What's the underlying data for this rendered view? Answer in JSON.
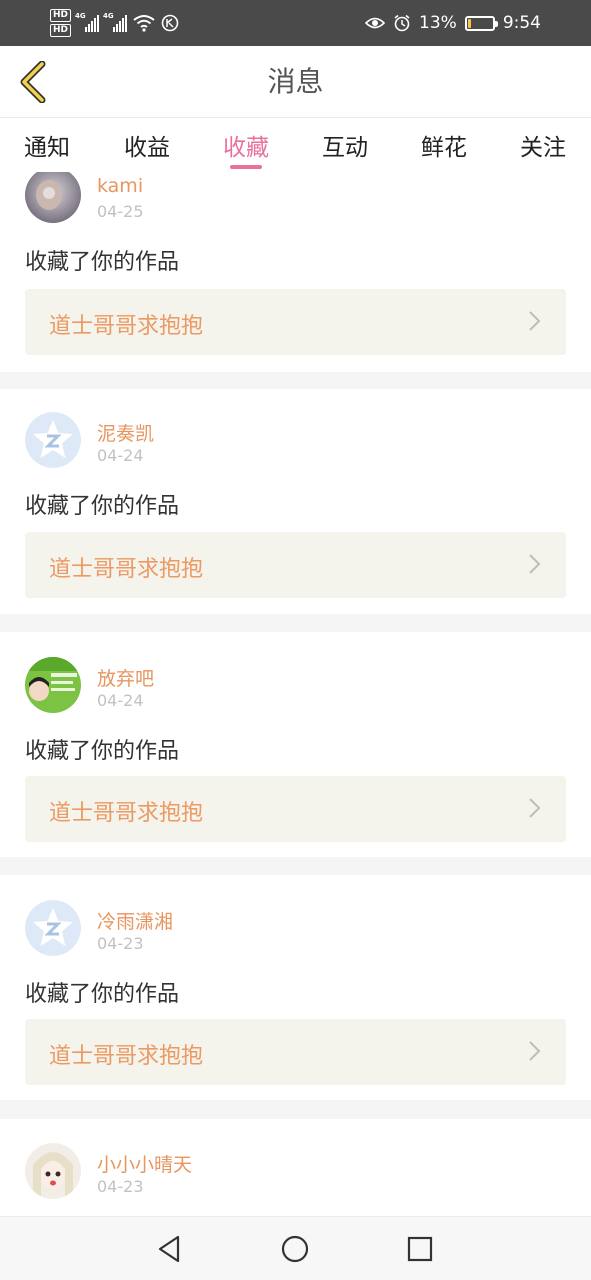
{
  "status_bar": {
    "hd1": "HD",
    "hd2": "HD",
    "net1": "4G",
    "net2": "4G",
    "battery_text": "13%",
    "battery_level": 0.13,
    "time": "9:54"
  },
  "header": {
    "title": "消息",
    "back_icon": "chevron-left-icon"
  },
  "tabs": [
    {
      "label": "通知"
    },
    {
      "label": "收益"
    },
    {
      "label": "收藏",
      "active": true
    },
    {
      "label": "互动"
    },
    {
      "label": "鲜花"
    },
    {
      "label": "关注"
    }
  ],
  "feed": [
    {
      "user": "kami",
      "date": "04-25",
      "action": "收藏了你的作品",
      "work": "道士哥哥求抱抱",
      "avatar": "photo"
    },
    {
      "user": "泥奏凯",
      "date": "04-24",
      "action": "收藏了你的作品",
      "work": "道士哥哥求抱抱",
      "avatar": "qq-default"
    },
    {
      "user": "放弃吧",
      "date": "04-24",
      "action": "收藏了你的作品",
      "work": "道士哥哥求抱抱",
      "avatar": "green-photo"
    },
    {
      "user": "冷雨潇湘",
      "date": "04-23",
      "action": "收藏了你的作品",
      "work": "道士哥哥求抱抱",
      "avatar": "qq-default"
    },
    {
      "user": "小小小晴天",
      "date": "04-23",
      "avatar": "anime-girl"
    }
  ],
  "nav": {
    "back": "triangle-back-icon",
    "home": "circle-home-icon",
    "recents": "square-recents-icon"
  },
  "colors": {
    "accent": "#e8719e",
    "username": "#e8955f",
    "work_title": "#ec9a63",
    "work_bg": "#f4f3ec"
  }
}
